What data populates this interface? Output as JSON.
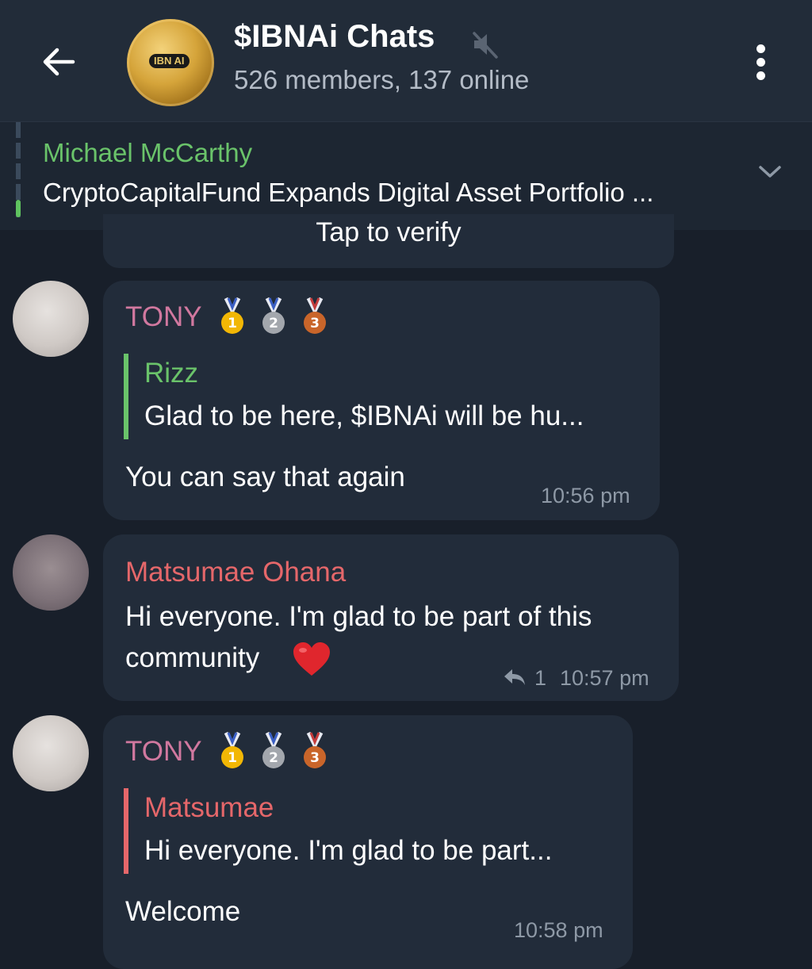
{
  "header": {
    "title": "$IBNAi Chats",
    "subtitle": "526 members, 137 online",
    "avatar_logo": "IBN AI",
    "icons": [
      "back-arrow-icon",
      "mute-icon",
      "more-vertical-icon"
    ]
  },
  "pinned": {
    "name": "Michael McCarthy",
    "text": "CryptoCapitalFund Expands Digital Asset Portfolio ..."
  },
  "verify": {
    "text": "Tap to verify"
  },
  "messages": [
    {
      "sender": "TONY",
      "sender_color": "#d1789f",
      "badges": [
        "1st-place-medal",
        "2nd-place-medal",
        "3rd-place-medal"
      ],
      "reply_name": "Rizz",
      "reply_color": "#6ac36a",
      "reply_text": "Glad to be here, $IBNAi will be hu...",
      "text": "You can say that again",
      "time": "10:56 pm"
    },
    {
      "sender": "Matsumae Ohana",
      "sender_color": "#e5676a",
      "text_line1": "Hi everyone. I'm glad to be part of this",
      "text_line2": "community",
      "emoji": "❤️",
      "reply_count": "1",
      "time": "10:57 pm"
    },
    {
      "sender": "TONY",
      "sender_color": "#d1789f",
      "badges": [
        "1st-place-medal",
        "2nd-place-medal",
        "3rd-place-medal"
      ],
      "reply_name": "Matsumae",
      "reply_color": "#e5676a",
      "reply_text": "Hi everyone. I'm glad to be part...",
      "text": "Welcome",
      "time": "10:58 pm"
    }
  ]
}
